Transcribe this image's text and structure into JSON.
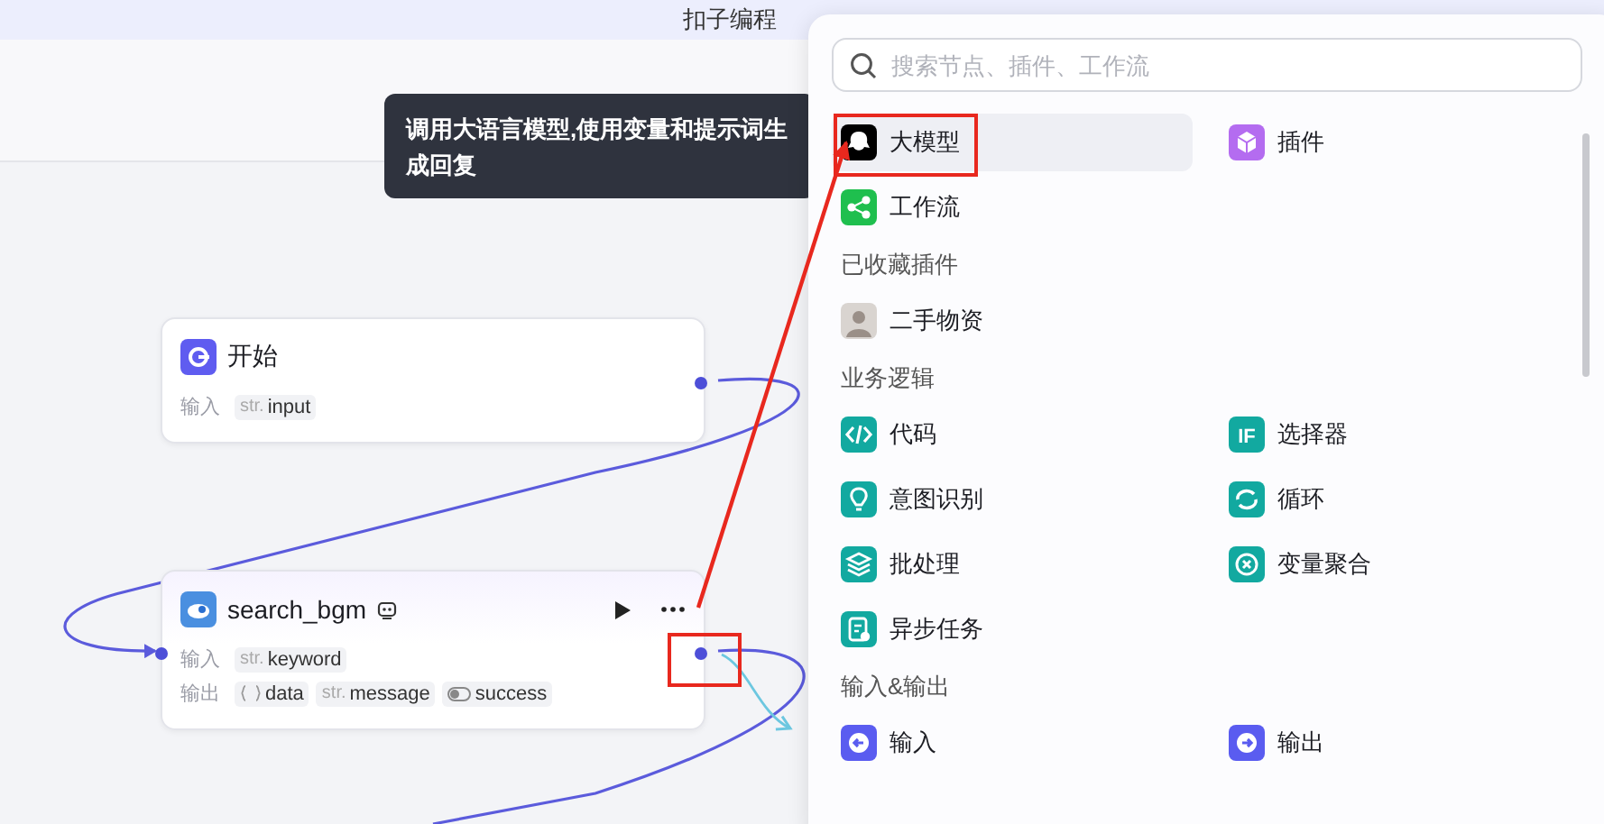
{
  "banner": {
    "text": "扣子编程"
  },
  "tooltip": {
    "text": "调用大语言模型,使用变量和提示词生成回复"
  },
  "nodes": [
    {
      "kind": "start",
      "title": "开始",
      "rows": [
        {
          "label": "输入",
          "params": [
            {
              "kind": "str",
              "prefix": "str.",
              "name": "input"
            }
          ]
        }
      ]
    },
    {
      "kind": "plugin",
      "title": "search_bgm",
      "rows": [
        {
          "label": "输入",
          "params": [
            {
              "kind": "str",
              "prefix": "str.",
              "name": "keyword"
            }
          ]
        },
        {
          "label": "输出",
          "params": [
            {
              "kind": "object",
              "name": "data"
            },
            {
              "kind": "str",
              "prefix": "str.",
              "name": "message"
            },
            {
              "kind": "boolean",
              "name": "success"
            }
          ]
        }
      ]
    }
  ],
  "picker": {
    "search": {
      "placeholder": "搜索节点、插件、工作流"
    },
    "sections": [
      {
        "items": [
          {
            "kind": "llm",
            "label": "大模型",
            "color": "#000000",
            "selected": true
          },
          {
            "kind": "plugin",
            "label": "插件",
            "color": "#b46cf0",
            "selected": false
          },
          {
            "kind": "workflow",
            "label": "工作流",
            "color": "#1fbf4e",
            "selected": false
          }
        ]
      },
      {
        "heading": "已收藏插件",
        "items": [
          {
            "kind": "avatar",
            "label": "二手物资",
            "color": "#d9d4d0",
            "selected": false
          }
        ]
      },
      {
        "heading": "业务逻辑",
        "items": [
          {
            "kind": "code",
            "label": "代码",
            "color": "#12a9a0",
            "selected": false
          },
          {
            "kind": "if",
            "glyph": "IF",
            "label": "选择器",
            "color": "#12a9a0",
            "selected": false
          },
          {
            "kind": "intent",
            "label": "意图识别",
            "color": "#12a9a0",
            "selected": false
          },
          {
            "kind": "loop",
            "label": "循环",
            "color": "#12a9a0",
            "selected": false
          },
          {
            "kind": "batch",
            "label": "批处理",
            "color": "#12a9a0",
            "selected": false
          },
          {
            "kind": "aggregate",
            "label": "变量聚合",
            "color": "#12a9a0",
            "selected": false
          },
          {
            "kind": "async",
            "label": "异步任务",
            "color": "#12a9a0",
            "selected": false
          }
        ]
      },
      {
        "heading": "输入&输出",
        "items": [
          {
            "kind": "input",
            "label": "输入",
            "color": "#5a5cf0",
            "selected": false
          },
          {
            "kind": "output",
            "label": "输出",
            "color": "#5a5cf0",
            "selected": false
          }
        ]
      }
    ]
  }
}
